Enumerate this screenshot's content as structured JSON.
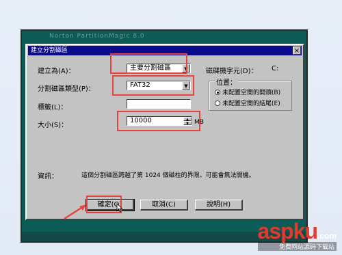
{
  "background_window": {
    "title": "Norton PartitionMagic 8.0"
  },
  "dialog": {
    "title": "建立分割磁區",
    "close_label": "×",
    "create_as": {
      "label": "建立為(A)：",
      "value": "主要分割磁區"
    },
    "drive_letter": {
      "label": "磁碟機字元(D)：",
      "value": "C:"
    },
    "partition_type": {
      "label": "分割磁區類型(P)：",
      "value": "FAT32"
    },
    "volume_label": {
      "label": "標籤(L)：",
      "value": ""
    },
    "size": {
      "label": "大小(S)：",
      "value": "10000",
      "unit": "MB"
    },
    "position": {
      "title": "位置：",
      "options": [
        {
          "label": "未配置空間的開頭(B)",
          "selected": true
        },
        {
          "label": "未配置空間的結尾(E)",
          "selected": false
        }
      ]
    },
    "info": {
      "label": "資訊：",
      "text": "這個分割磁區跨越了第 1024 個磁柱的界限。可能會無法開機。"
    },
    "buttons": {
      "ok": "確定(O)",
      "cancel": "取消(C)",
      "help": "說明(H)"
    }
  },
  "watermark": {
    "brand": "aspku",
    "domain": ".com",
    "caption": "免费网站源码下载站"
  },
  "colors": {
    "highlight": "#e8423a",
    "titlebar": "#0a0a8c",
    "dialog_face": "#c3c3c3"
  }
}
